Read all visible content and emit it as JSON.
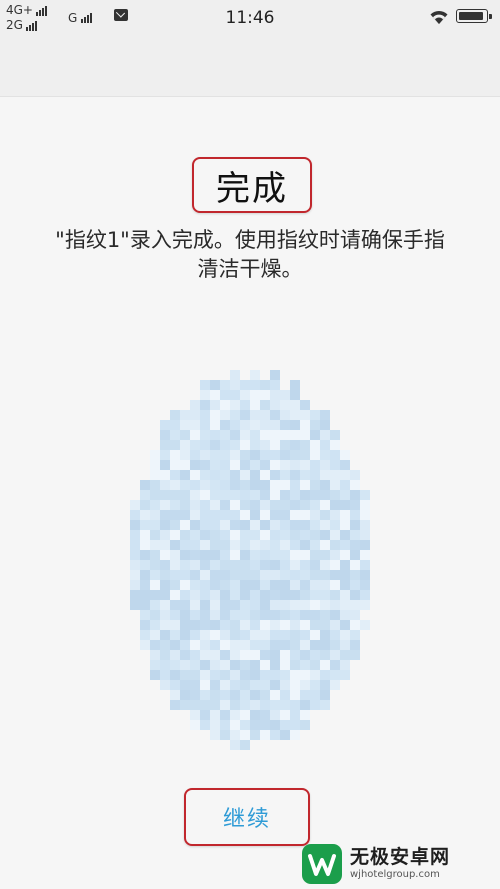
{
  "status_bar": {
    "network_1": "4G+",
    "network_2": "2G",
    "network_3": "G",
    "time": "11:46"
  },
  "title": "完成",
  "message_line1": "\"指纹1\"录入完成。使用指纹时请确保手指",
  "message_line2": "清洁干燥。",
  "continue_label": "继续",
  "watermark": {
    "main": "无极安卓网",
    "sub": "wjhotelgroup.com"
  },
  "colors": {
    "accent": "#2e9bd6",
    "highlight_box": "#c1272d",
    "fingerprint": "#cde2f2"
  }
}
